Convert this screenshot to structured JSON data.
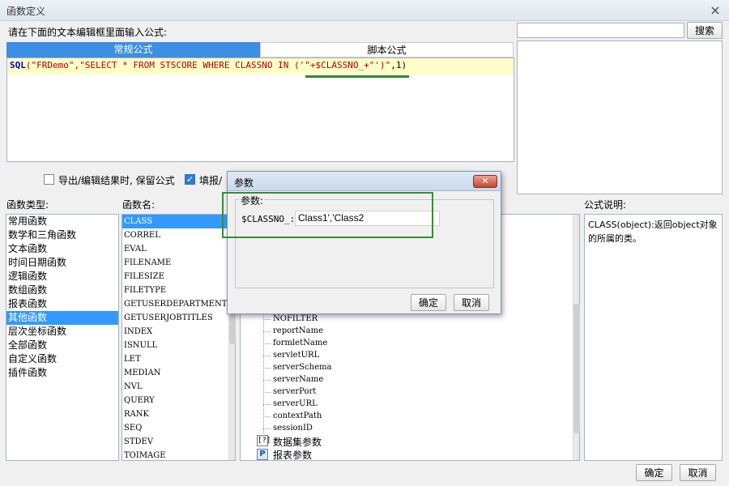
{
  "window": {
    "title": "函数定义",
    "close_glyph": "×"
  },
  "instruction": "请在下面的文本编辑框里面输入公式:",
  "tabs": [
    {
      "label": "常规公式",
      "active": true
    },
    {
      "label": "脚本公式",
      "active": false
    }
  ],
  "formula": {
    "fn": "SQL",
    "p1": "(",
    "s1": "\"FRDemo\"",
    "p2": ",",
    "s2": "\"SELECT * FROM STSCORE WHERE CLASSNO IN ('\"",
    "p3": "+$CLASSNO_+",
    "s3": "\"')\"",
    "p4": ",1)"
  },
  "search": {
    "value": "",
    "button_label": "搜索"
  },
  "options": {
    "export_keep_label": "导出/编辑结果时, 保留公式",
    "export_keep_checked": false,
    "fill_label": "填报/",
    "fill_checked": true,
    "check_glyph": "✓"
  },
  "headers": {
    "types": "函数类型:",
    "names": "函数名:",
    "description": "公式说明:"
  },
  "function_types": [
    "常用函数",
    "数学和三角函数",
    "文本函数",
    "时间日期函数",
    "逻辑函数",
    "数组函数",
    "报表函数",
    "其他函数",
    "层次坐标函数",
    "全部函数",
    "自定义函数",
    "插件函数"
  ],
  "selected_type": "其他函数",
  "function_names": [
    "CLASS",
    "CORREL",
    "EVAL",
    "FILENAME",
    "FILESIZE",
    "FILETYPE",
    "GETUSERDEPARTMENTS",
    "GETUSERJOBTITLES",
    "INDEX",
    "ISNULL",
    "LET",
    "MEDIAN",
    "NVL",
    "QUERY",
    "RANK",
    "SEQ",
    "STDEV",
    "TOIMAGE"
  ],
  "selected_name": "CLASS",
  "tree_items": [
    "NOFILTER",
    "reportName",
    "formletName",
    "servletURL",
    "serverSchema",
    "serverName",
    "serverPort",
    "serverURL",
    "contextPath",
    "sessionID"
  ],
  "tree_groups": [
    {
      "label": "数据集参数",
      "icon": "[?]",
      "icon_name": "dataset-param-icon"
    },
    {
      "label": "报表参数",
      "icon": "P",
      "icon_name": "report-param-icon"
    }
  ],
  "description": "CLASS(object):返回object对象的所属的类。",
  "footer": {
    "ok": "确定",
    "cancel": "取消"
  },
  "dialog": {
    "title": "参数",
    "close_glyph": "✕",
    "group_label": "参数:",
    "param_label": "$CLASSNO_:",
    "param_value": "Class1','Class2",
    "ok": "确定",
    "cancel": "取消"
  },
  "colors": {
    "accent": "#3c8fe3",
    "selection": "#3399ff",
    "highlight": "#2e8b2e",
    "editor_bg": "#ffffc8"
  }
}
